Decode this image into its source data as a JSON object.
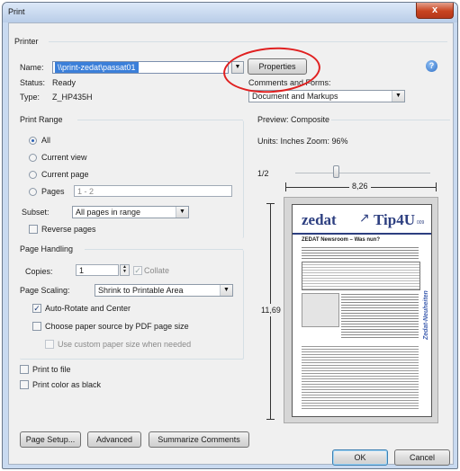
{
  "window": {
    "title": "Print",
    "close": "x"
  },
  "printer": {
    "section": "Printer",
    "name_label": "Name:",
    "name_value": "\\\\print-zedat\\passat01",
    "properties_button": "Properties",
    "status_label": "Status:",
    "status_value": "Ready",
    "type_label": "Type:",
    "type_value": "Z_HP435H",
    "comments_label": "Comments and Forms:",
    "comments_value": "Document and Markups",
    "help": "?"
  },
  "print_range": {
    "section": "Print Range",
    "options": [
      "All",
      "Current view",
      "Current page",
      "Pages"
    ],
    "selected": "All",
    "pages_value": "1 - 2",
    "subset_label": "Subset:",
    "subset_value": "All pages in range",
    "reverse_label": "Reverse pages"
  },
  "page_handling": {
    "section": "Page Handling",
    "copies_label": "Copies:",
    "copies_value": "1",
    "collate_label": "Collate",
    "scaling_label": "Page Scaling:",
    "scaling_value": "Shrink to Printable Area",
    "auto_rotate_label": "Auto-Rotate and Center",
    "auto_rotate_checked": true,
    "paper_source_label": "Choose paper source by PDF page size",
    "custom_paper_label": "Use custom paper size when needed"
  },
  "print_to_file": "Print to file",
  "print_color_black": "Print color as black",
  "preview": {
    "section": "Preview: Composite",
    "units": "Units: Inches Zoom: 96%",
    "page_indicator": "1/2",
    "width": "8,26",
    "height": "11,69",
    "brand_left": "zedat",
    "brand_right": "Tip4U",
    "brand_sub": "009",
    "headline": "ZEDAT Newsroom – Was nun?",
    "side_text": "Zedat-Neuheiten"
  },
  "buttons": {
    "page_setup": "Page Setup...",
    "advanced": "Advanced",
    "summarize": "Summarize Comments",
    "ok": "OK",
    "cancel": "Cancel"
  },
  "annotation_color": "#e02020",
  "accent_color": "#3b7fd9"
}
